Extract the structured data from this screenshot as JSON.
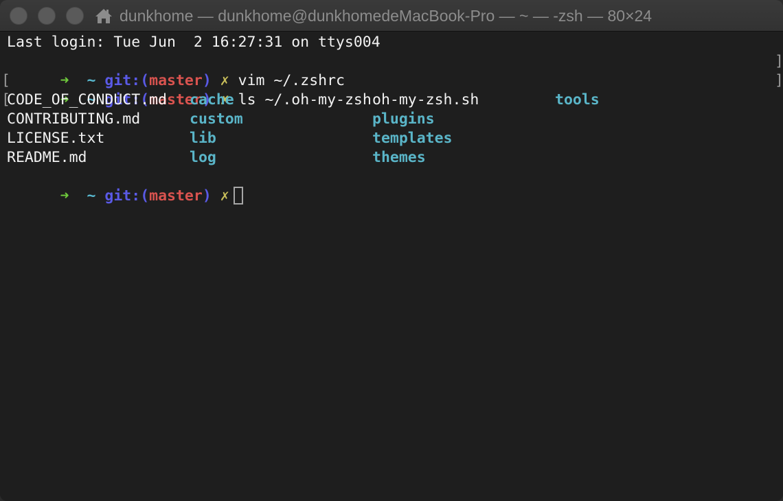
{
  "window": {
    "title": "dunkhome — dunkhome@dunkhomedeMacBook-Pro — ~ — -zsh — 80×24"
  },
  "terminal": {
    "last_login": "Last login: Tue Jun  2 16:27:31 on ttys004",
    "prompt": {
      "arrow": "➜",
      "cwd": "~",
      "git_prefix": "git:(",
      "branch": "master",
      "git_suffix": ")",
      "dirty": "✗"
    },
    "commands": [
      "vim ~/.zshrc",
      "ls ~/.oh-my-zsh"
    ],
    "ls_output": [
      [
        {
          "name": "CODE_OF_CONDUCT.md",
          "dir": false
        },
        {
          "name": "cache",
          "dir": true
        },
        {
          "name": "oh-my-zsh.sh",
          "dir": false
        },
        {
          "name": "tools",
          "dir": true
        }
      ],
      [
        {
          "name": "CONTRIBUTING.md",
          "dir": false
        },
        {
          "name": "custom",
          "dir": true
        },
        {
          "name": "plugins",
          "dir": true
        }
      ],
      [
        {
          "name": "LICENSE.txt",
          "dir": false
        },
        {
          "name": "lib",
          "dir": true
        },
        {
          "name": "templates",
          "dir": true
        }
      ],
      [
        {
          "name": "README.md",
          "dir": false
        },
        {
          "name": "log",
          "dir": true
        },
        {
          "name": "themes",
          "dir": true
        }
      ]
    ]
  },
  "colors": {
    "arrow": "#6ec83c",
    "cwd": "#58b8cf",
    "git": "#5a5ae6",
    "branch": "#d9534f",
    "dirty": "#c9bf5a",
    "directory": "#5ab5c8"
  },
  "icons": {
    "title": "home-icon"
  }
}
